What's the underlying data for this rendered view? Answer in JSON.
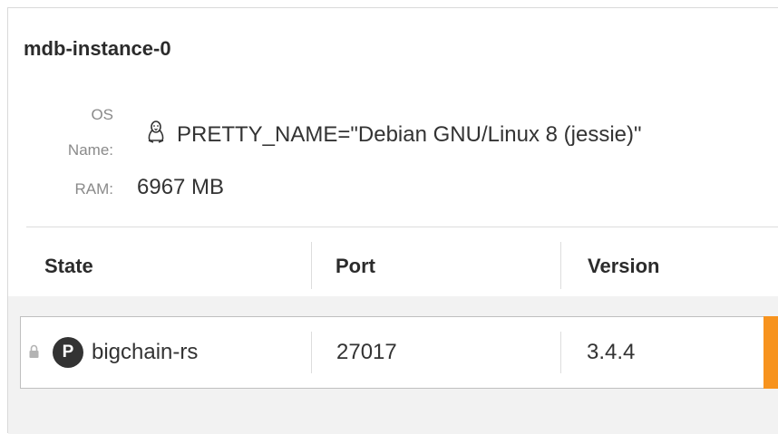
{
  "host": {
    "name": "mdb-instance-0"
  },
  "info": {
    "os_label_line1": "OS",
    "os_label_line2": "Name:",
    "os_value": "PRETTY_NAME=\"Debian GNU/Linux 8 (jessie)\"",
    "os_icon": "linux-tux-icon",
    "ram_label": "RAM:",
    "ram_value": "6967 MB"
  },
  "table": {
    "columns": [
      "State",
      "Port",
      "Version"
    ],
    "rows": [
      {
        "lock_icon": "lock-icon",
        "badge": "P",
        "name": "bigchain-rs",
        "port": "27017",
        "version": "3.4.4",
        "accent_color": "#f7931e"
      }
    ]
  }
}
